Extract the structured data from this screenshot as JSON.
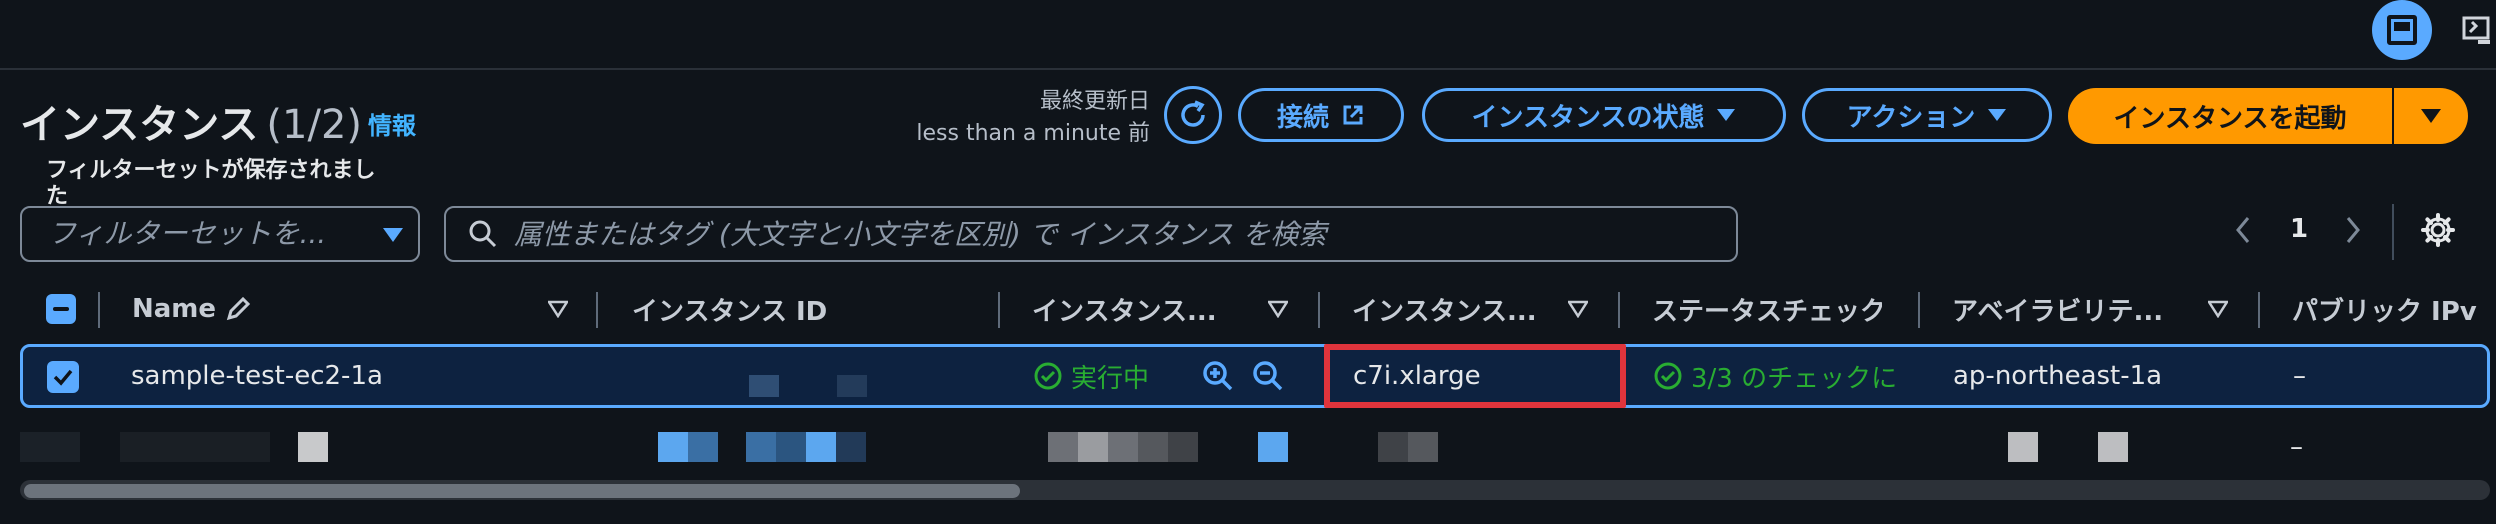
{
  "header": {
    "title": "インスタンス",
    "count": "(1/2)",
    "info_link": "情報",
    "last_updated_label": "最終更新日",
    "last_updated_value": "less than a minute 前"
  },
  "actions": {
    "connect": "接続",
    "instance_state": "インスタンスの状態",
    "actions": "アクション",
    "launch": "インスタンスを起動"
  },
  "filter": {
    "saved_label": "フィルターセットが保存されました",
    "select_placeholder": "フィルターセットを...",
    "search_placeholder": "属性またはタグ (大文字と小文字を区別) で インスタンス を検索"
  },
  "pagination": {
    "page": "1"
  },
  "table": {
    "columns": [
      "Name",
      "インスタンス ID",
      "インスタンス...",
      "インスタンス...",
      "ステータスチェック",
      "アベイラビリテ...",
      "パブリック IPv"
    ],
    "rows": [
      {
        "name": "sample-test-ec2-1a",
        "state": "実行中",
        "type": "c7i.xlarge",
        "status_check": "3/3 のチェックに",
        "az": "ap-northeast-1a",
        "public_ip": "–"
      },
      {
        "public_ip": "–"
      }
    ]
  },
  "colors": {
    "accent": "#5aaaff",
    "primary_button": "#ff9900",
    "success": "#29ad32",
    "highlight": "#e0343c",
    "background": "#0f141a"
  }
}
